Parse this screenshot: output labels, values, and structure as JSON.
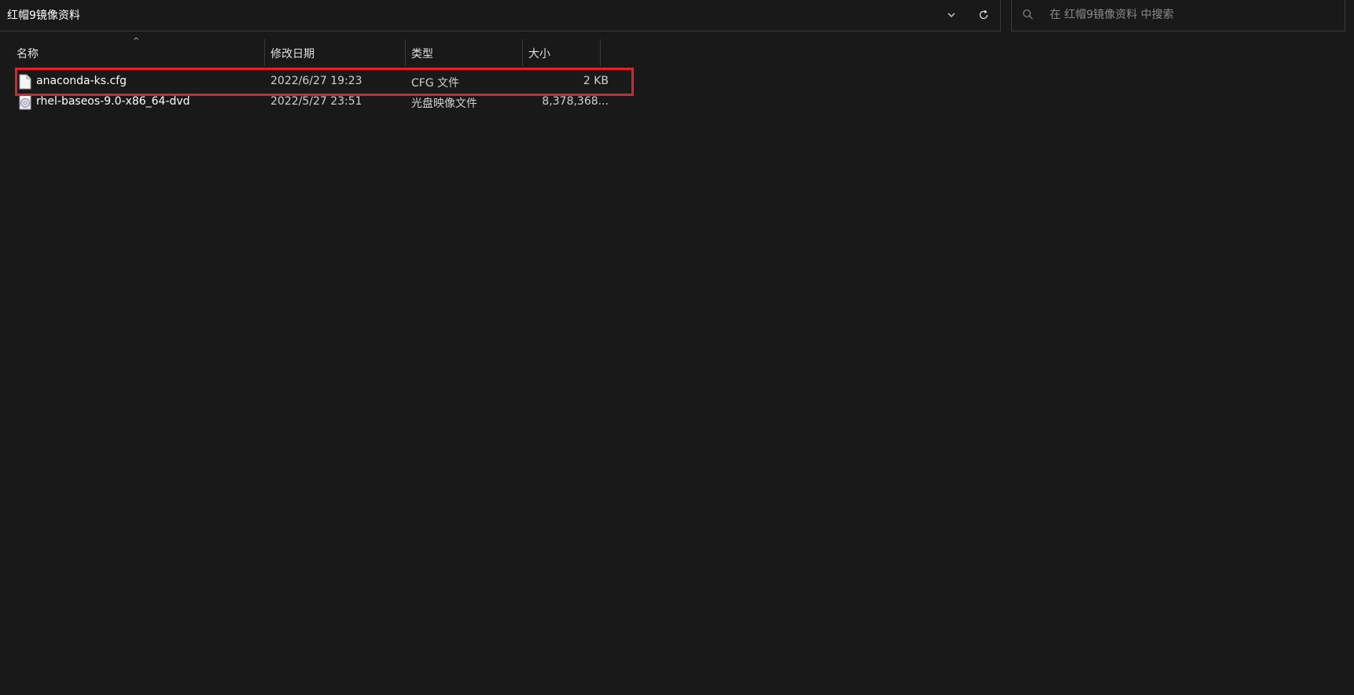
{
  "address_bar": {
    "path": "红帽9镜像资料",
    "dropdown_icon": "chevron-down-icon",
    "refresh_icon": "refresh-icon"
  },
  "search": {
    "placeholder": "在 红帽9镜像资料 中搜索",
    "icon": "search-icon"
  },
  "columns": {
    "name": "名称",
    "date": "修改日期",
    "type": "类型",
    "size": "大小",
    "sort_indicator": "^"
  },
  "files": [
    {
      "name": "anaconda-ks.cfg",
      "date": "2022/6/27 19:23",
      "type": "CFG 文件",
      "size": "2 KB",
      "icon": "document-file-icon",
      "highlighted": true
    },
    {
      "name": "rhel-baseos-9.0-x86_64-dvd",
      "date": "2022/5/27 23:51",
      "type": "光盘映像文件",
      "size": "8,378,368...",
      "icon": "disc-image-icon",
      "highlighted": false
    }
  ],
  "colors": {
    "background": "#191919",
    "highlight_border": "#e0202a",
    "text": "#ffffff"
  }
}
